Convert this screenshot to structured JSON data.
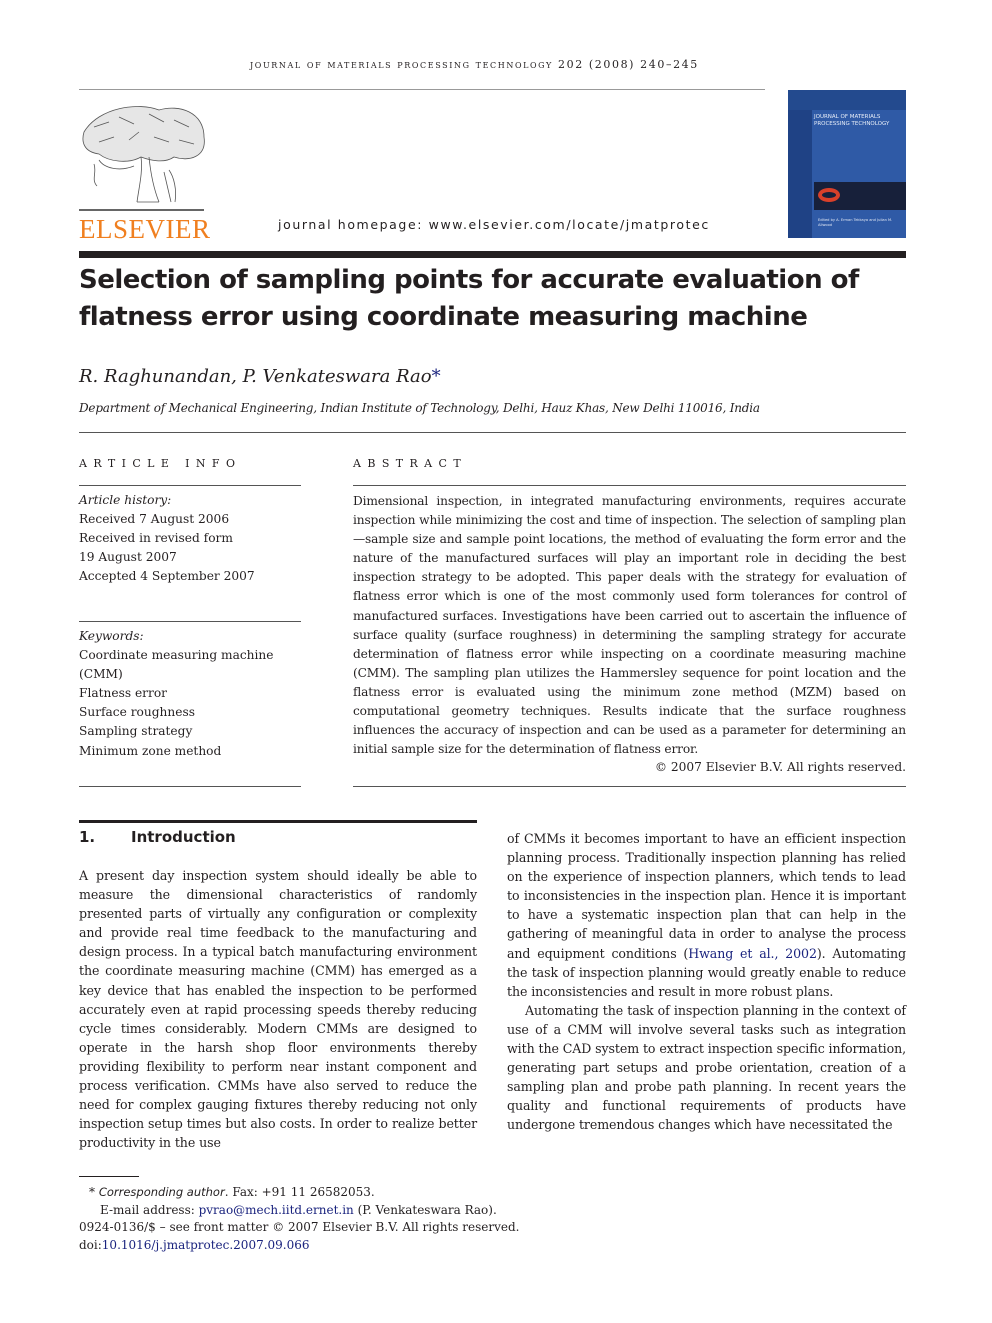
{
  "header": {
    "running_head": "journal of materials processing technology 202 (2008) 240–245",
    "publisher_logo_text": "ELSEVIER",
    "homepage": "journal homepage: www.elsevier.com/locate/jmatprotec",
    "cover": {
      "title": "JOURNAL OF MATERIALS PROCESSING TECHNOLOGY",
      "editors": "Edited by A. Erman Tekkaya and Julian M. Allwood"
    }
  },
  "article": {
    "title": "Selection of sampling points for accurate evaluation of flatness error using coordinate measuring machine",
    "authors": "R. Raghunandan, P. Venkateswara Rao",
    "corresponding_mark": "*",
    "affiliation": "Department of Mechanical Engineering, Indian Institute of Technology, Delhi, Hauz Khas, New Delhi 110016, India"
  },
  "article_info": {
    "label": "Article Info",
    "history_label": "Article history:",
    "history": [
      "Received 7 August 2006",
      "Received in revised form",
      "19 August 2007",
      "Accepted 4 September 2007"
    ],
    "keywords_label": "Keywords:",
    "keywords": [
      "Coordinate measuring machine",
      "(CMM)",
      "Flatness error",
      "Surface roughness",
      "Sampling strategy",
      "Minimum zone method"
    ]
  },
  "abstract": {
    "label": "Abstract",
    "text": "Dimensional inspection, in integrated manufacturing environments, requires accurate inspection while minimizing the cost and time of inspection. The selection of sampling plan—sample size and sample point locations, the method of evaluating the form error and the nature of the manufactured surfaces will play an important role in deciding the best inspection strategy to be adopted. This paper deals with the strategy for evaluation of flatness error which is one of the most commonly used form tolerances for control of manufactured surfaces. Investigations have been carried out to ascertain the influence of surface quality (surface roughness) in determining the sampling strategy for accurate determination of flatness error while inspecting on a coordinate measuring machine (CMM). The sampling plan utilizes the Hammersley sequence for point location and the flatness error is evaluated using the minimum zone method (MZM) based on computational geometry techniques. Results indicate that the surface roughness influences the accuracy of inspection and can be used as a parameter for determining an initial sample size for the determination of flatness error.",
    "copyright": "© 2007 Elsevier B.V. All rights reserved."
  },
  "introduction": {
    "number": "1.",
    "heading": "Introduction",
    "para1": "A present day inspection system should ideally be able to measure the dimensional characteristics of randomly presented parts of virtually any configuration or complexity and provide real time feedback to the manufacturing and design process. In a typical batch manufacturing environment the coordinate measuring machine (CMM) has emerged as a key device that has enabled the inspection to be performed accurately even at rapid processing speeds thereby reducing cycle times considerably. Modern CMMs are designed to operate in the harsh shop floor environments thereby providing flexibility to perform near instant component and process verification. CMMs have also served to reduce the need for complex gauging fixtures thereby reducing not only inspection setup times but also costs. In order to realize better productivity in the use",
    "para1_cont_before_ref": "of CMMs it becomes important to have an efficient inspection planning process. Traditionally inspection planning has relied on the experience of inspection planners, which tends to lead to inconsistencies in the inspection plan. Hence it is important to have a systematic inspection plan that can help in the gathering of meaningful data in order to analyse the process and equipment conditions (",
    "ref_hwang": "Hwang et al., 2002",
    "para1_cont_after_ref": "). Automating the task of inspection planning would greatly enable to reduce the inconsistencies and result in more robust plans.",
    "para2": "Automating the task of inspection planning in the context of use of a CMM will involve several tasks such as integration with the CAD system to extract inspection specific information, generating part setups and probe orientation, creation of a sampling plan and probe path planning. In recent years the quality and functional requirements of products have undergone tremendous changes which have necessitated the"
  },
  "footnotes": {
    "mark": "*",
    "corresponding_label": "Corresponding author",
    "fax": ". Fax: +91 11 26582053.",
    "email_label": "E-mail address: ",
    "email": "pvrao@mech.iitd.ernet.in",
    "email_owner": " (P. Venkateswara Rao).",
    "issn_line": "0924-0136/$ – see front matter © 2007 Elsevier B.V. All rights reserved.",
    "doi_label": "doi:",
    "doi": "10.1016/j.jmatprotec.2007.09.066"
  }
}
